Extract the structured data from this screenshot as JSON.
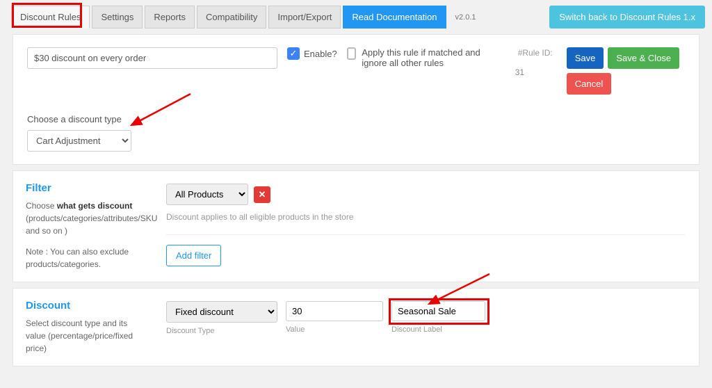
{
  "tabs": {
    "discount_rules": "Discount Rules",
    "settings": "Settings",
    "reports": "Reports",
    "compatibility": "Compatibility",
    "import_export": "Import/Export",
    "read_documentation": "Read Documentation"
  },
  "version": "v2.0.1",
  "switch_back": "Switch back to Discount Rules 1.x",
  "top": {
    "rule_name": "$30 discount on every order",
    "enable_label": "Enable?",
    "apply_label": "Apply this rule if matched and ignore all other rules",
    "rule_id_label": "#Rule ID:",
    "rule_id": "31",
    "save": "Save",
    "save_close": "Save & Close",
    "cancel": "Cancel",
    "discount_type_label": "Choose a discount type",
    "discount_type_value": "Cart Adjustment"
  },
  "filter": {
    "title": "Filter",
    "desc_pre": "Choose ",
    "desc_bold": "what gets discount",
    "desc_post": " (products/categories/attributes/SKU and so on )",
    "note": "Note : You can also exclude products/categories.",
    "select_value": "All Products",
    "help": "Discount applies to all eligible products in the store",
    "add_filter": "Add filter"
  },
  "discount": {
    "title": "Discount",
    "desc": "Select discount type and its value (percentage/price/fixed price)",
    "type_value": "Fixed discount",
    "value": "30",
    "label_value": "Seasonal Sale",
    "col_type": "Discount Type",
    "col_value": "Value",
    "col_label": "Discount Label"
  }
}
